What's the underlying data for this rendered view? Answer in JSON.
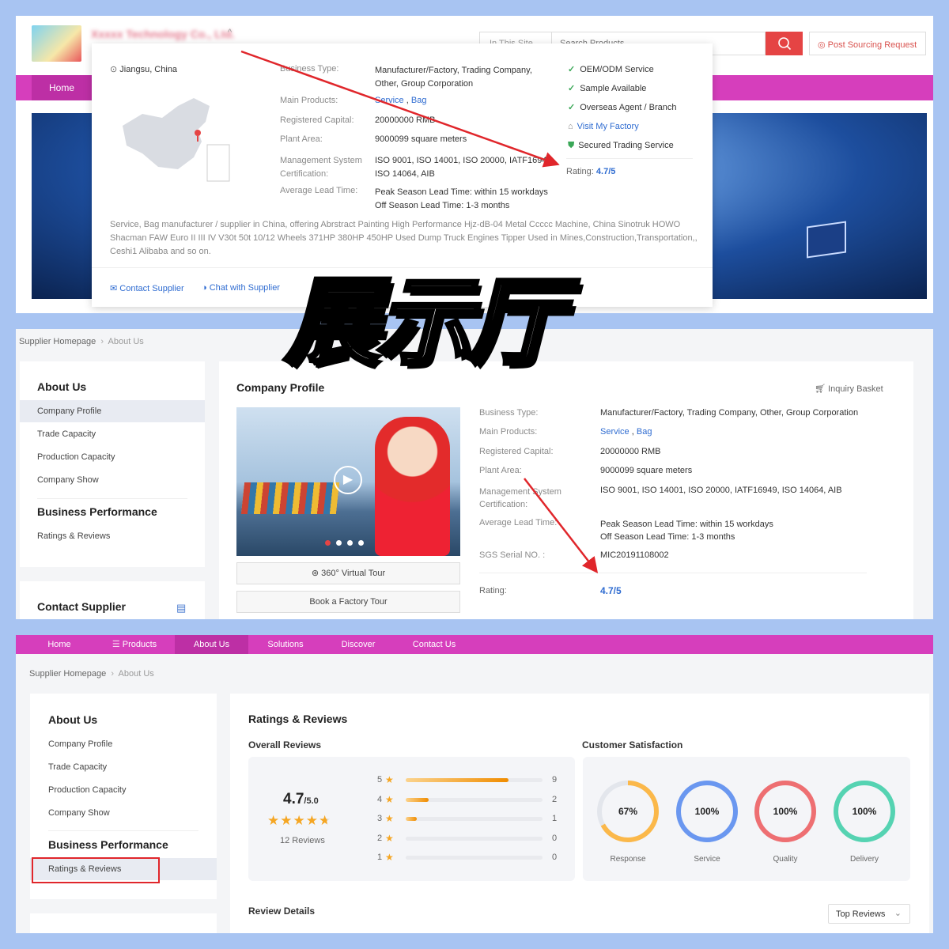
{
  "overlay_title": "展示厅",
  "colors": {
    "nav": "#d63ebc",
    "nav_active": "#bd2fa5",
    "link": "#2f6cd1",
    "search_button": "#e54444",
    "highlight_box": "#e0262b",
    "arrow": "#e0262b"
  },
  "header": {
    "company_name": "Xxxxx Technology Co., Ltd.",
    "search_scope_placeholder": "In This Site",
    "search_placeholder": "Search Products",
    "post_sourcing_label": "Post Sourcing Request",
    "nav_home": "Home"
  },
  "popover": {
    "location": "Jiangsu, China",
    "rows": [
      {
        "label": "Business Type:",
        "value": [
          "Manufacturer/Factory, Trading Company,",
          "Other, Group Corporation"
        ]
      },
      {
        "label": "Main Products:",
        "links": [
          "Service",
          "Bag"
        ]
      },
      {
        "label": "Registered Capital:",
        "value": [
          "20000000 RMB"
        ]
      },
      {
        "label": "Plant Area:",
        "value": [
          "9000099 square meters"
        ]
      },
      {
        "label": [
          "Management System",
          "Certification:"
        ],
        "value": [
          "ISO 9001, ISO 14001, ISO 20000, IATF16949,",
          "ISO 14064, AIB"
        ]
      },
      {
        "label": "Average Lead Time:",
        "value": [
          "Peak Season Lead Time: within 15 workdays",
          "Off Season Lead Time: 1-3 months"
        ]
      }
    ],
    "features": [
      "OEM/ODM Service",
      "Sample Available",
      "Overseas Agent / Branch"
    ],
    "visit_factory": "Visit My Factory",
    "secured_trading": "Secured Trading Service",
    "rating_label": "Rating:",
    "rating_value": "4.7/5",
    "description": [
      "Service, Bag manufacturer / supplier in China, offering Abrstract Painting High Performance Hjz-dB-04 Metal Ccccc Machine, China Sinotruk HOWO",
      "Shacman FAW Euro II III IV V30t 50t 10/12 Wheels 371HP 380HP 450HP Used Dump Truck Engines Tipper Used in Mines,Construction,Transportation,,",
      "Ceshi1 Alibaba and so on."
    ],
    "contact_supplier": "Contact Supplier",
    "chat_supplier": "Chat with Supplier"
  },
  "profile_page": {
    "breadcrumb": [
      "Supplier Homepage",
      "About Us"
    ],
    "sidebar": {
      "about_heading": "About Us",
      "about_items": [
        "Company Profile",
        "Trade Capacity",
        "Production Capacity",
        "Company Show"
      ],
      "performance_heading": "Business Performance",
      "performance_items": [
        "Ratings & Reviews"
      ],
      "contact_heading": "Contact Supplier"
    },
    "title": "Company Profile",
    "inquiry_basket": "Inquiry Basket",
    "virtual_tour": "360° Virtual Tour",
    "factory_tour": "Book a Factory Tour",
    "video_slides": 5,
    "video_active_slide": 1,
    "rows": [
      {
        "label": "Business Type:",
        "value": "Manufacturer/Factory, Trading Company, Other, Group Corporation"
      },
      {
        "label": "Main Products:",
        "links": [
          "Service",
          "Bag"
        ]
      },
      {
        "label": "Registered Capital:",
        "value": "20000000 RMB"
      },
      {
        "label": "Plant Area:",
        "value": "9000099 square meters"
      },
      {
        "label": [
          "Management System",
          "Certification:"
        ],
        "value": "ISO 9001, ISO 14001, ISO 20000, IATF16949, ISO 14064, AIB"
      },
      {
        "label": "Average Lead Time:",
        "value": [
          "Peak Season Lead Time: within 15 workdays",
          "Off Season Lead Time: 1-3 months"
        ]
      },
      {
        "label": "SGS Serial NO. :",
        "value": "MIC20191108002"
      }
    ],
    "rating_label": "Rating:",
    "rating_value": "4.7/5"
  },
  "reviews_page": {
    "nav": [
      "Home",
      "Products",
      "About Us",
      "Solutions",
      "Discover",
      "Contact Us"
    ],
    "nav_active": "About Us",
    "breadcrumb": [
      "Supplier Homepage",
      "About Us"
    ],
    "sidebar": {
      "about_heading": "About Us",
      "about_items": [
        "Company Profile",
        "Trade Capacity",
        "Production Capacity",
        "Company Show"
      ],
      "performance_heading": "Business Performance",
      "performance_items": [
        "Ratings & Reviews"
      ]
    },
    "title": "Ratings & Reviews",
    "overall_heading": "Overall Reviews",
    "score": "4.7",
    "score_max": "/5.0",
    "score_value": 4.7,
    "review_count": "12 Reviews",
    "distribution": [
      {
        "stars": "5",
        "count": 9
      },
      {
        "stars": "4",
        "count": 2
      },
      {
        "stars": "3",
        "count": 1
      },
      {
        "stars": "2",
        "count": 0
      },
      {
        "stars": "1",
        "count": 0
      }
    ],
    "satisfaction_heading": "Customer Satisfaction",
    "satisfaction": [
      {
        "label": "Response",
        "percent": 67,
        "text": "67%",
        "color": "#fbb84a"
      },
      {
        "label": "Service",
        "percent": 100,
        "text": "100%",
        "color": "#6a97f0"
      },
      {
        "label": "Quality",
        "percent": 100,
        "text": "100%",
        "color": "#ee6f72"
      },
      {
        "label": "Delivery",
        "percent": 100,
        "text": "100%",
        "color": "#55d3b2"
      }
    ],
    "review_details": "Review Details",
    "sort_select": "Top Reviews"
  }
}
